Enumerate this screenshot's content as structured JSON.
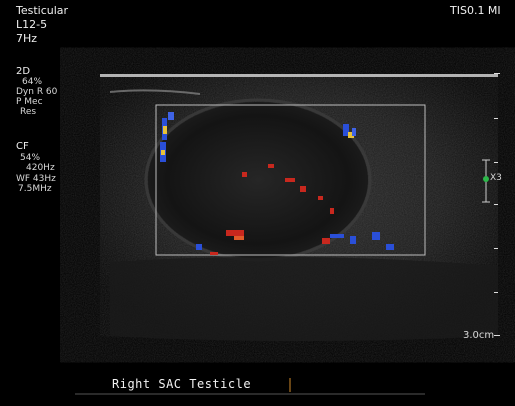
{
  "header": {
    "preset": "Testicular",
    "probe": "L12-5",
    "frame_rate": "7Hz",
    "safety": "TIS0.1  MI"
  },
  "mode_2d": {
    "label": "2D",
    "gain": "64%",
    "dyn_range": "Dyn R 60",
    "persistence": "P Mec",
    "resolution": "Res"
  },
  "mode_cf": {
    "label": "CF",
    "gain": "54%",
    "prf": "420Hz",
    "wall_filter": "WF  43Hz",
    "frequency": "7.5MHz"
  },
  "scale": {
    "zoom": "X3",
    "depth": "3.0cm"
  },
  "annotation": {
    "text": "Right  SAC Testicle"
  },
  "colors": {
    "doppler_red": "#c8281e",
    "doppler_blue": "#2a4fd8",
    "doppler_yellow": "#e8c23a",
    "focus_marker": "#2db84a"
  }
}
